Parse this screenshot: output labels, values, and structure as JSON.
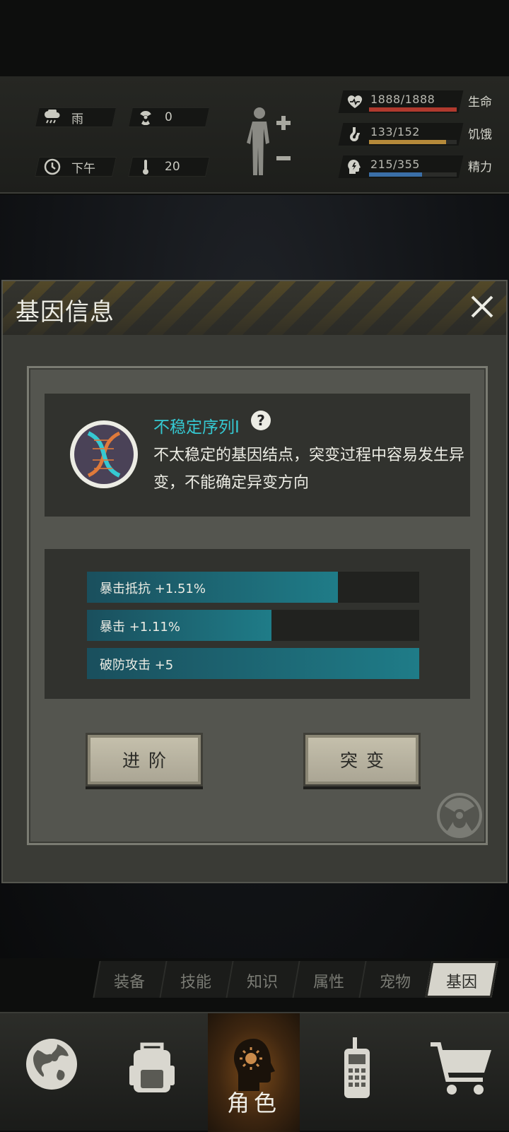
{
  "status": {
    "weather": "雨",
    "radiation": "0",
    "time": "下午",
    "temperature": "20"
  },
  "vitals": [
    {
      "value": "1888/1888",
      "label": "生命",
      "ratio": 1.0,
      "color": "#b0392e",
      "icon": "heart-pulse-icon"
    },
    {
      "value": "133/152",
      "label": "饥饿",
      "ratio": 0.875,
      "color": "#b58a3a",
      "icon": "stomach-icon"
    },
    {
      "value": "215/355",
      "label": "精力",
      "ratio": 0.606,
      "color": "#3a6fa8",
      "icon": "energy-head-icon"
    }
  ],
  "dialog": {
    "title": "基因信息",
    "gene_name": "不稳定序列Ⅰ",
    "gene_desc": "不太稳定的基因结点，突变过程中容易发生异变，不能确定异变方向",
    "stats": [
      {
        "label": "暴击抵抗 +1.51%",
        "ratio": 0.755
      },
      {
        "label": "暴击 +1.11%",
        "ratio": 0.555
      },
      {
        "label": "破防攻击 +5",
        "ratio": 1.0
      }
    ],
    "advance_label": "进阶",
    "mutate_label": "突变"
  },
  "tabs": [
    {
      "label": "装备",
      "active": false
    },
    {
      "label": "技能",
      "active": false
    },
    {
      "label": "知识",
      "active": false
    },
    {
      "label": "属性",
      "active": false
    },
    {
      "label": "宠物",
      "active": false
    },
    {
      "label": "基因",
      "active": true
    }
  ],
  "nav": {
    "items": [
      "globe-icon",
      "backpack-icon",
      "character-icon",
      "radio-icon",
      "cart-icon"
    ],
    "active_label": "角色"
  }
}
